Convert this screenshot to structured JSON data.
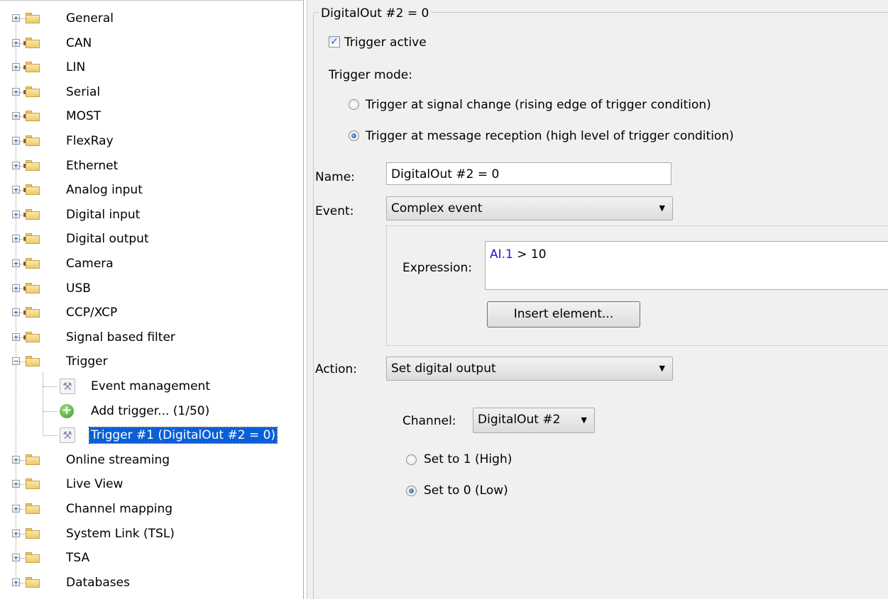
{
  "tree": {
    "roots": [
      {
        "label": "General",
        "icon": "folder-icon"
      },
      {
        "label": "CAN",
        "icon": "plug-folder-icon"
      },
      {
        "label": "LIN",
        "icon": "plug-folder-icon"
      },
      {
        "label": "Serial",
        "icon": "plug-folder-icon"
      },
      {
        "label": "MOST",
        "icon": "plug-folder-icon"
      },
      {
        "label": "FlexRay",
        "icon": "plug-folder-icon"
      },
      {
        "label": "Ethernet",
        "icon": "plug-folder-icon"
      },
      {
        "label": "Analog input",
        "icon": "plug-folder-icon"
      },
      {
        "label": "Digital input",
        "icon": "plug-folder-icon"
      },
      {
        "label": "Digital output",
        "icon": "plug-folder-icon"
      },
      {
        "label": "Camera",
        "icon": "plug-folder-icon"
      },
      {
        "label": "USB",
        "icon": "plug-folder-icon"
      },
      {
        "label": "CCP/XCP",
        "icon": "plug-folder-icon"
      },
      {
        "label": "Signal based filter",
        "icon": "plug-folder-icon"
      },
      {
        "label": "Trigger",
        "icon": "folder-icon"
      },
      {
        "label": "Online streaming",
        "icon": "folder-icon"
      },
      {
        "label": "Live View",
        "icon": "folder-icon"
      },
      {
        "label": "Channel mapping",
        "icon": "folder-icon"
      },
      {
        "label": "System Link (TSL)",
        "icon": "folder-icon"
      },
      {
        "label": "TSA",
        "icon": "folder-icon"
      },
      {
        "label": "Databases",
        "icon": "folder-icon"
      }
    ],
    "trigger_children": [
      {
        "label": "Event management",
        "icon": "wrench-icon"
      },
      {
        "label": "Add trigger... (1/50)",
        "icon": "add-icon"
      },
      {
        "label": "Trigger #1 (DigitalOut #2 = 0)",
        "icon": "wrench-icon",
        "selected": true
      }
    ],
    "expand_glyph": "+",
    "collapse_glyph": "−"
  },
  "panel": {
    "group_title": "DigitalOut #2 = 0",
    "trigger_active_label": "Trigger active",
    "trigger_active_checked": true,
    "trigger_mode_label": "Trigger mode:",
    "mode_signal_change": "Trigger at signal change (rising edge of trigger condition)",
    "mode_message_reception": "Trigger at message reception (high level of trigger condition)",
    "mode_selected": "message_reception",
    "name_label": "Name:",
    "name_value": "DigitalOut #2 = 0",
    "event_label": "Event:",
    "event_value": "Complex event",
    "expression_label": "Expression:",
    "expression_token": "AI.1",
    "expression_rest": " > 10",
    "insert_element_label": "Insert element...",
    "action_label": "Action:",
    "action_value": "Set digital output",
    "channel_label": "Channel:",
    "channel_value": "DigitalOut #2",
    "set_high_label": "Set to 1 (High)",
    "set_low_label": "Set to 0 (Low)",
    "set_selected": "low",
    "colors": {
      "selection": "#0a5fd6",
      "token": "#1a1ad6"
    }
  }
}
